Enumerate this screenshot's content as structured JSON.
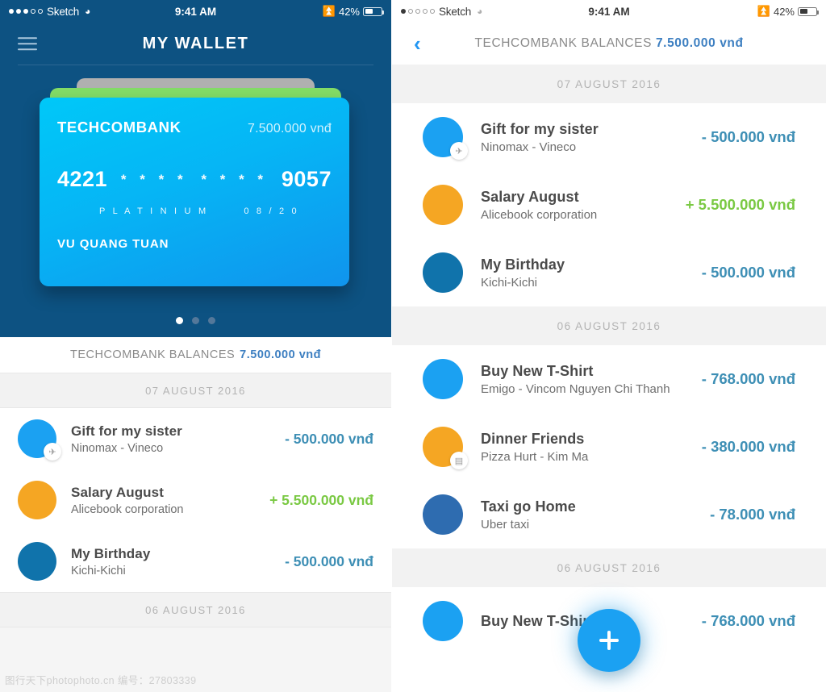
{
  "left": {
    "status_bar": {
      "carrier": "Sketch",
      "signal_filled": 3,
      "signal_total": 5,
      "wifi_icon": "wifi-icon",
      "time": "9:41 AM",
      "bluetooth_icon": "bluetooth-icon",
      "battery_percent": "42%",
      "battery_level": 42
    },
    "nav": {
      "menu_icon": "hamburger-menu-icon",
      "title": "MY WALLET"
    },
    "card": {
      "bank": "TECHCOMBANK",
      "balance": "7.500.000 vnđ",
      "number_prefix": "4221",
      "number_mask_1": "* * * *",
      "number_mask_2": "* * * *",
      "number_suffix": "9057",
      "tier": "P L A T I N I U M",
      "expiry": "0 8 / 2 0",
      "holder": "VU QUANG TUAN",
      "front_color": "#06b5f5",
      "middle_color": "#83dd67",
      "back_color": "#b0b0b0"
    },
    "pager": {
      "total": 3,
      "active": 1
    },
    "balance_bar": {
      "label": "TECHCOMBANK BALANCES",
      "value": "7.500.000 vnđ"
    },
    "groups": [
      {
        "date": "07 AUGUST 2016",
        "transactions": [
          {
            "title": "Gift for my sister",
            "subtitle": "Ninomax - Vineco",
            "amount": "- 500.000 vnđ",
            "sign": "neg",
            "avatar_color": "#1ba1f2",
            "badge_icon": "airplane-icon",
            "badge_glyph": "✈"
          },
          {
            "title": "Salary August",
            "subtitle": "Alicebook corporation",
            "amount": "+ 5.500.000 vnđ",
            "sign": "pos",
            "avatar_color": "#f5a623",
            "badge_icon": "",
            "badge_glyph": ""
          },
          {
            "title": "My Birthday",
            "subtitle": "Kichi-Kichi",
            "amount": "- 500.000 vnđ",
            "sign": "neg",
            "avatar_color": "#1073ab",
            "badge_icon": "",
            "badge_glyph": ""
          }
        ]
      },
      {
        "date": "06 AUGUST 2016",
        "transactions": []
      }
    ]
  },
  "right": {
    "status_bar": {
      "carrier": "Sketch",
      "signal_filled": 1,
      "signal_total": 5,
      "wifi_icon": "wifi-icon",
      "time": "9:41 AM",
      "bluetooth_icon": "bluetooth-icon",
      "battery_percent": "42%",
      "battery_level": 42
    },
    "nav": {
      "back_icon": "chevron-left-icon",
      "label": "TECHCOMBANK BALANCES",
      "value": "7.500.000 vnđ"
    },
    "groups": [
      {
        "date": "07 AUGUST 2016",
        "transactions": [
          {
            "title": "Gift for my sister",
            "subtitle": "Ninomax - Vineco",
            "amount": "- 500.000 vnđ",
            "sign": "neg",
            "avatar_color": "#1ba1f2",
            "badge_icon": "airplane-icon",
            "badge_glyph": "✈"
          },
          {
            "title": "Salary August",
            "subtitle": "Alicebook corporation",
            "amount": "+ 5.500.000 vnđ",
            "sign": "pos",
            "avatar_color": "#f5a623",
            "badge_icon": "",
            "badge_glyph": ""
          },
          {
            "title": "My Birthday",
            "subtitle": "Kichi-Kichi",
            "amount": "- 500.000 vnđ",
            "sign": "neg",
            "avatar_color": "#1073ab",
            "badge_icon": "",
            "badge_glyph": ""
          }
        ]
      },
      {
        "date": "06 AUGUST 2016",
        "transactions": [
          {
            "title": "Buy New T-Shirt",
            "subtitle": "Emigo - Vincom Nguyen Chi Thanh",
            "amount": "- 768.000 vnđ",
            "sign": "neg",
            "avatar_color": "#1ba1f2",
            "badge_icon": "",
            "badge_glyph": ""
          },
          {
            "title": "Dinner Friends",
            "subtitle": "Pizza Hurt - Kim Ma",
            "amount": "- 380.000 vnđ",
            "sign": "neg",
            "avatar_color": "#f5a623",
            "badge_icon": "receipt-icon",
            "badge_glyph": "▤"
          },
          {
            "title": "Taxi go Home",
            "subtitle": "Uber taxi",
            "amount": "- 78.000 vnđ",
            "sign": "neg",
            "avatar_color": "#2e6cb0",
            "badge_icon": "",
            "badge_glyph": ""
          }
        ]
      },
      {
        "date": "06 AUGUST 2016",
        "transactions": [
          {
            "title": "Buy New T-Shirt",
            "subtitle": "",
            "amount": "- 768.000 vnđ",
            "sign": "neg",
            "avatar_color": "#1ba1f2",
            "badge_icon": "",
            "badge_glyph": ""
          }
        ]
      }
    ],
    "fab": {
      "icon": "plus-icon",
      "color": "#1ba1f2"
    }
  },
  "watermark": "图行天下photophoto.cn  编号：27803339"
}
